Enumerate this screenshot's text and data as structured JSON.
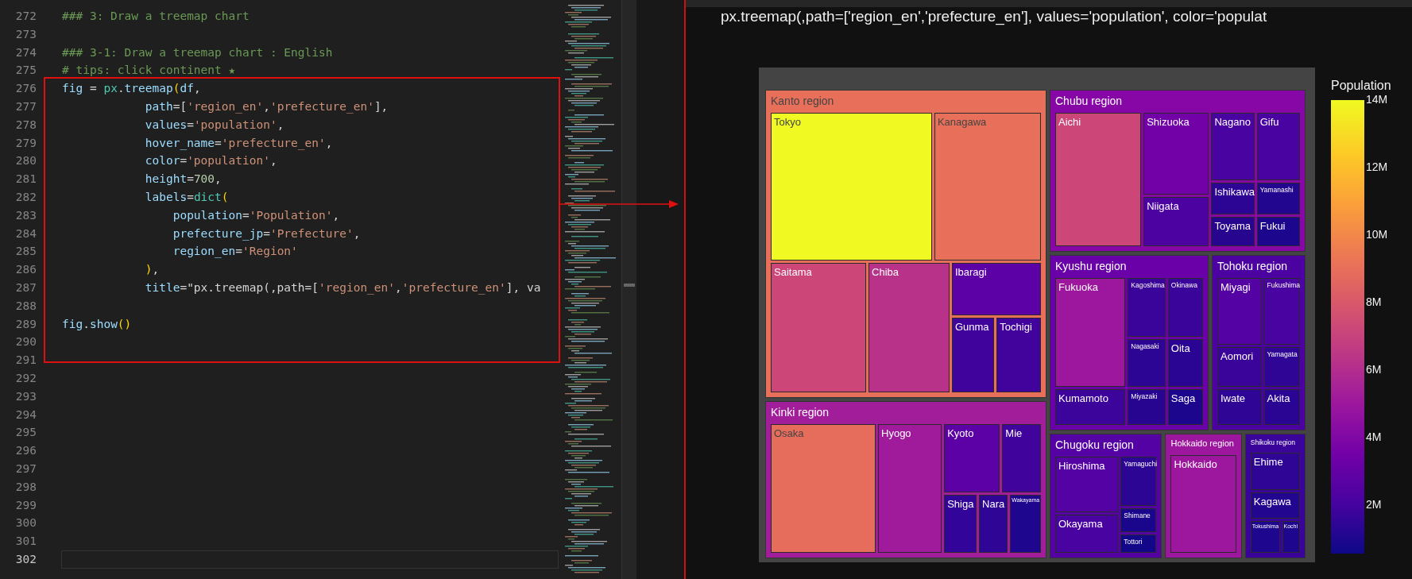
{
  "editor": {
    "lines": [
      {
        "number": "272",
        "tokens": [
          {
            "kind": "comment",
            "text": "### 3: Draw a treemap chart"
          }
        ]
      },
      {
        "number": "273"
      },
      {
        "number": "274",
        "tokens": [
          {
            "kind": "comment",
            "text": "### 3-1: Draw a treemap chart : English"
          }
        ]
      },
      {
        "number": "275",
        "tokens": [
          {
            "kind": "comment",
            "text": "# tips: click continent ★"
          }
        ]
      }
    ],
    "highlight_box": {
      "lines": [
        {
          "number": "276",
          "tokens": [
            {
              "kind": "name",
              "text": "fig"
            },
            {
              "kind": "op",
              "text": " = "
            },
            {
              "kind": "module",
              "text": "px"
            },
            {
              "kind": "op",
              "text": "."
            },
            {
              "kind": "name",
              "text": "treemap"
            },
            {
              "kind": "bracket",
              "text": "("
            },
            {
              "kind": "name",
              "text": "df"
            },
            {
              "kind": "op",
              "text": ","
            }
          ]
        },
        {
          "number": "277",
          "tokens": [
            {
              "kind": "name",
              "text": "            path"
            },
            {
              "kind": "op",
              "text": "=["
            },
            {
              "kind": "string",
              "text": "'region_en'"
            },
            {
              "kind": "op",
              "text": ","
            },
            {
              "kind": "string",
              "text": "'prefecture_en'"
            },
            {
              "kind": "op",
              "text": "],"
            }
          ]
        },
        {
          "number": "278",
          "tokens": [
            {
              "kind": "name",
              "text": "            values"
            },
            {
              "kind": "op",
              "text": "="
            },
            {
              "kind": "string",
              "text": "'population'"
            },
            {
              "kind": "op",
              "text": ","
            }
          ]
        },
        {
          "number": "279",
          "tokens": [
            {
              "kind": "name",
              "text": "            hover_name"
            },
            {
              "kind": "op",
              "text": "="
            },
            {
              "kind": "string",
              "text": "'prefecture_en'"
            },
            {
              "kind": "op",
              "text": ","
            }
          ]
        },
        {
          "number": "280",
          "tokens": [
            {
              "kind": "name",
              "text": "            color"
            },
            {
              "kind": "op",
              "text": "="
            },
            {
              "kind": "string",
              "text": "'population'"
            },
            {
              "kind": "op",
              "text": ","
            }
          ]
        },
        {
          "number": "281",
          "tokens": [
            {
              "kind": "name",
              "text": "            height"
            },
            {
              "kind": "op",
              "text": "="
            },
            {
              "kind": "number",
              "text": "700"
            },
            {
              "kind": "op",
              "text": ","
            }
          ]
        },
        {
          "number": "282",
          "tokens": [
            {
              "kind": "name",
              "text": "            labels"
            },
            {
              "kind": "op",
              "text": "="
            },
            {
              "kind": "module",
              "text": "dict"
            },
            {
              "kind": "bracket",
              "text": "("
            }
          ]
        },
        {
          "number": "283",
          "tokens": [
            {
              "kind": "name",
              "text": "                population"
            },
            {
              "kind": "op",
              "text": "="
            },
            {
              "kind": "string",
              "text": "'Population'"
            },
            {
              "kind": "op",
              "text": ","
            }
          ]
        },
        {
          "number": "284",
          "tokens": [
            {
              "kind": "name",
              "text": "                prefecture_jp"
            },
            {
              "kind": "op",
              "text": "="
            },
            {
              "kind": "string",
              "text": "'Prefecture'"
            },
            {
              "kind": "op",
              "text": ","
            }
          ]
        },
        {
          "number": "285",
          "tokens": [
            {
              "kind": "name",
              "text": "                region_en"
            },
            {
              "kind": "op",
              "text": "="
            },
            {
              "kind": "string",
              "text": "'Region'"
            }
          ]
        },
        {
          "number": "286",
          "tokens": [
            {
              "kind": "bracket",
              "text": "            )"
            },
            {
              "kind": "op",
              "text": ","
            }
          ]
        },
        {
          "number": "287",
          "tokens": [
            {
              "kind": "name",
              "text": "            title"
            },
            {
              "kind": "op",
              "text": "=\"px.treemap(,path=["
            },
            {
              "kind": "string",
              "text": "'region_en'"
            },
            {
              "kind": "op",
              "text": ","
            },
            {
              "kind": "string",
              "text": "'prefecture_en'"
            },
            {
              "kind": "op",
              "text": "], va"
            }
          ]
        },
        {
          "number": "288"
        },
        {
          "number": "289",
          "tokens": [
            {
              "kind": "name",
              "text": "fig"
            },
            {
              "kind": "op",
              "text": "."
            },
            {
              "kind": "name",
              "text": "show"
            },
            {
              "kind": "bracket",
              "text": "()"
            }
          ]
        },
        {
          "number": "290"
        }
      ]
    },
    "lines_after": [
      {
        "number": "291"
      },
      {
        "number": "292"
      },
      {
        "number": "293"
      },
      {
        "number": "294"
      },
      {
        "number": "295"
      },
      {
        "number": "296"
      },
      {
        "number": "297"
      },
      {
        "number": "298"
      },
      {
        "number": "299"
      },
      {
        "number": "300"
      },
      {
        "number": "301"
      }
    ],
    "cursor_line": {
      "number": "302"
    }
  },
  "output": {
    "title": "px.treemap(,path=['region_en','prefecture_en'], values='population', color='populat",
    "treemap": {
      "regions": [
        {
          "name": "Kanto region",
          "color": "#e8705a",
          "prefectures": [
            {
              "name": "Tokyo",
              "color": "#f0f921"
            },
            {
              "name": "Kanagawa",
              "color": "#e8705a"
            },
            {
              "name": "Saitama",
              "color": "#cc4778"
            },
            {
              "name": "Chiba",
              "color": "#b83289"
            },
            {
              "name": "Ibaragi",
              "color": "#5c01a6"
            },
            {
              "name": "Gunma",
              "color": "#40049c"
            },
            {
              "name": "Tochigi",
              "color": "#42039d"
            }
          ]
        },
        {
          "name": "Chubu region",
          "color": "#8606a6",
          "prefectures": [
            {
              "name": "Aichi",
              "color": "#cc4778"
            },
            {
              "name": "Shizuoka",
              "color": "#7201a8"
            },
            {
              "name": "Nagano",
              "color": "#4903a0"
            },
            {
              "name": "Gifu",
              "color": "#4903a0"
            },
            {
              "name": "Ishikawa",
              "color": "#2d0594"
            },
            {
              "name": "Yamanashi",
              "color": "#22068f"
            },
            {
              "name": "Niigata",
              "color": "#4c02a1"
            },
            {
              "name": "Toyama",
              "color": "#28058f"
            },
            {
              "name": "Fukui",
              "color": "#1c068e"
            }
          ]
        },
        {
          "name": "Kyushu region",
          "color": "#6a00a8",
          "prefectures": [
            {
              "name": "Fukuoka",
              "color": "#9c179e"
            },
            {
              "name": "Kagoshima",
              "color": "#3a049a"
            },
            {
              "name": "Okinawa",
              "color": "#3a049a"
            },
            {
              "name": "Nagasaki",
              "color": "#2d0594"
            },
            {
              "name": "Oita",
              "color": "#2a0593"
            },
            {
              "name": "Kumamoto",
              "color": "#3c049b"
            },
            {
              "name": "Miyazaki",
              "color": "#270591"
            },
            {
              "name": "Saga",
              "color": "#1c068e"
            }
          ]
        },
        {
          "name": "Tohoku region",
          "color": "#4c02a1",
          "prefectures": [
            {
              "name": "Miyagi",
              "color": "#5402a3"
            },
            {
              "name": "Fukushima",
              "color": "#4903a0"
            },
            {
              "name": "Aomori",
              "color": "#3a049a"
            },
            {
              "name": "Yamagata",
              "color": "#2f0596"
            },
            {
              "name": "Iwate",
              "color": "#2e0595"
            },
            {
              "name": "Akita",
              "color": "#2a0593"
            }
          ]
        },
        {
          "name": "Kinki region",
          "color": "#a21d9a",
          "prefectures": [
            {
              "name": "Osaka",
              "color": "#e66c5c"
            },
            {
              "name": "Hyogo",
              "color": "#a01a9c"
            },
            {
              "name": "Kyoto",
              "color": "#5c01a6"
            },
            {
              "name": "Mie",
              "color": "#40049c"
            },
            {
              "name": "Shiga",
              "color": "#32049a"
            },
            {
              "name": "Nara",
              "color": "#2e0595"
            },
            {
              "name": "Wakayama",
              "color": "#1e068f"
            }
          ]
        },
        {
          "name": "Chugoku region",
          "color": "#5402a3",
          "prefectures": [
            {
              "name": "Hiroshima",
              "color": "#5402a3"
            },
            {
              "name": "Okayama",
              "color": "#4903a0"
            },
            {
              "name": "Yamaguchi",
              "color": "#2d0594"
            },
            {
              "name": "Shimane",
              "color": "#1a068d"
            },
            {
              "name": "Tottori",
              "color": "#130789"
            }
          ]
        },
        {
          "name": "Hokkaido region",
          "color": "#9c179e",
          "prefectures": [
            {
              "name": "Hokkaido",
              "color": "#9c179e"
            }
          ]
        },
        {
          "name": "Shikoku region",
          "color": "#3a049a",
          "prefectures": [
            {
              "name": "Ehime",
              "color": "#2f0596"
            },
            {
              "name": "Kagawa",
              "color": "#230690"
            },
            {
              "name": "Tokushima",
              "color": "#1e068f"
            },
            {
              "name": "Kochi",
              "color": "#1e068f"
            }
          ]
        }
      ]
    },
    "colorbar": {
      "title": "Population",
      "ticks": [
        "14M",
        "12M",
        "10M",
        "8M",
        "6M",
        "4M",
        "2M"
      ]
    }
  }
}
